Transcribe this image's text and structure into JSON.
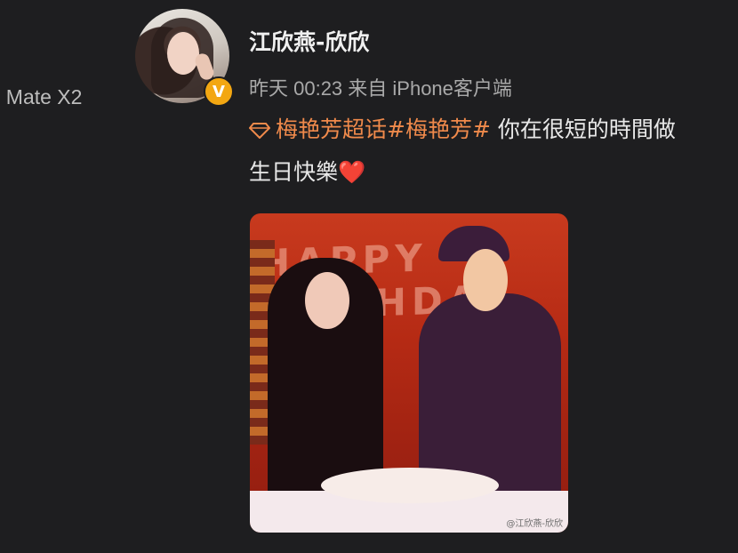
{
  "left_device": "I Mate X2",
  "post": {
    "username": "江欣燕-欣欣",
    "meta": "昨天 00:23 来自 iPhone客户端",
    "topic_link": "梅艳芳超话",
    "hashtag": "#梅艳芳#",
    "text_line1": " 你在很短的時間做",
    "text_line2": "生日快樂",
    "heart": "❤️",
    "verified_badge": "V",
    "photo_watermark": "@江欣燕-欣欣",
    "photo_sign_text": "HAPPY BIRTHDAY"
  },
  "colors": {
    "background": "#1e1e20",
    "hashtag": "#f08a4b",
    "verified_badge": "#f3a712"
  },
  "icons": {
    "topic": "diamond-icon",
    "verified": "verified-v-icon",
    "weibo": "weibo-logo-icon"
  }
}
